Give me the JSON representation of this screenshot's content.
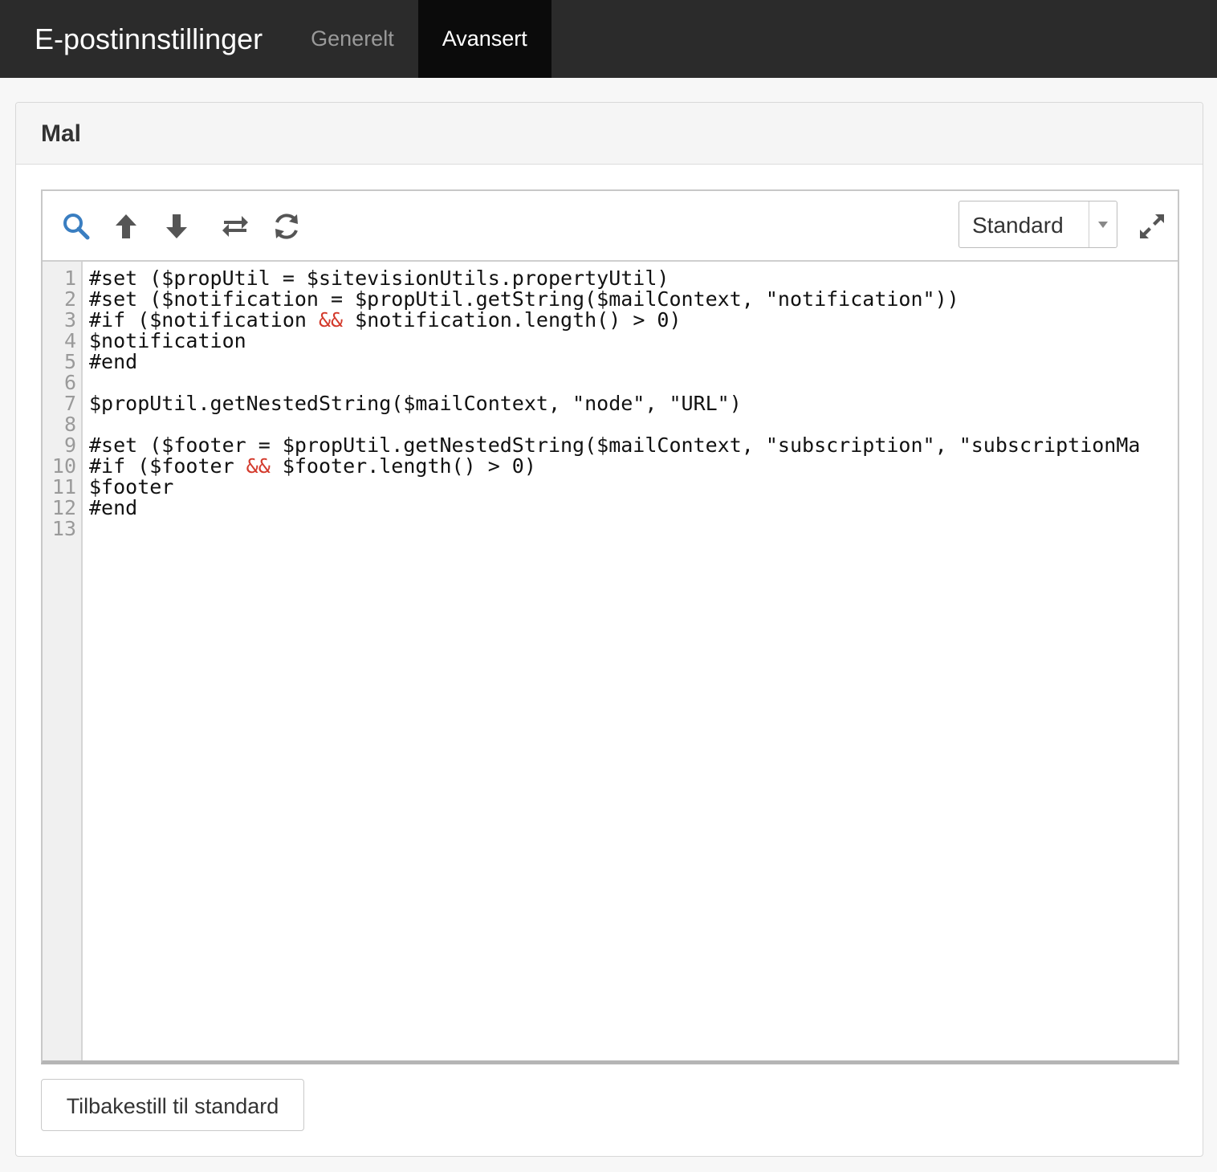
{
  "header": {
    "title": "E-postinnstillinger",
    "tabs": [
      {
        "label": "Generelt",
        "active": false
      },
      {
        "label": "Avansert",
        "active": true
      }
    ]
  },
  "panel": {
    "title": "Mal"
  },
  "editor": {
    "toolbar": {
      "icons": [
        "search-icon",
        "arrow-up-icon",
        "arrow-down-icon",
        "swap-icon",
        "refresh-icon",
        "expand-icon"
      ],
      "mode_select": {
        "value": "Standard"
      }
    },
    "line_numbers": [
      "1",
      "2",
      "3",
      "4",
      "5",
      "6",
      "7",
      "8",
      "9",
      "10",
      "11",
      "12",
      "13"
    ],
    "lines": [
      [
        "#set ($propUtil = $sitevisionUtils.propertyUtil)"
      ],
      [
        "#set ($notification = $propUtil.getString($mailContext, \"notification\"))"
      ],
      [
        "#if ($notification ",
        "&&",
        " $notification.length() > 0)"
      ],
      [
        "$notification"
      ],
      [
        "#end"
      ],
      [
        ""
      ],
      [
        "$propUtil.getNestedString($mailContext, \"node\", \"URL\")"
      ],
      [
        ""
      ],
      [
        "#set ($footer = $propUtil.getNestedString($mailContext, \"subscription\", \"subscriptionMa"
      ],
      [
        "#if ($footer ",
        "&&",
        " $footer.length() > 0)"
      ],
      [
        "$footer"
      ],
      [
        "#end"
      ],
      [
        ""
      ]
    ],
    "colors": {
      "operator": "#d33a2c",
      "accent_icon": "#3a7ec1"
    }
  },
  "footer": {
    "reset_label": "Tilbakestill til standard"
  }
}
